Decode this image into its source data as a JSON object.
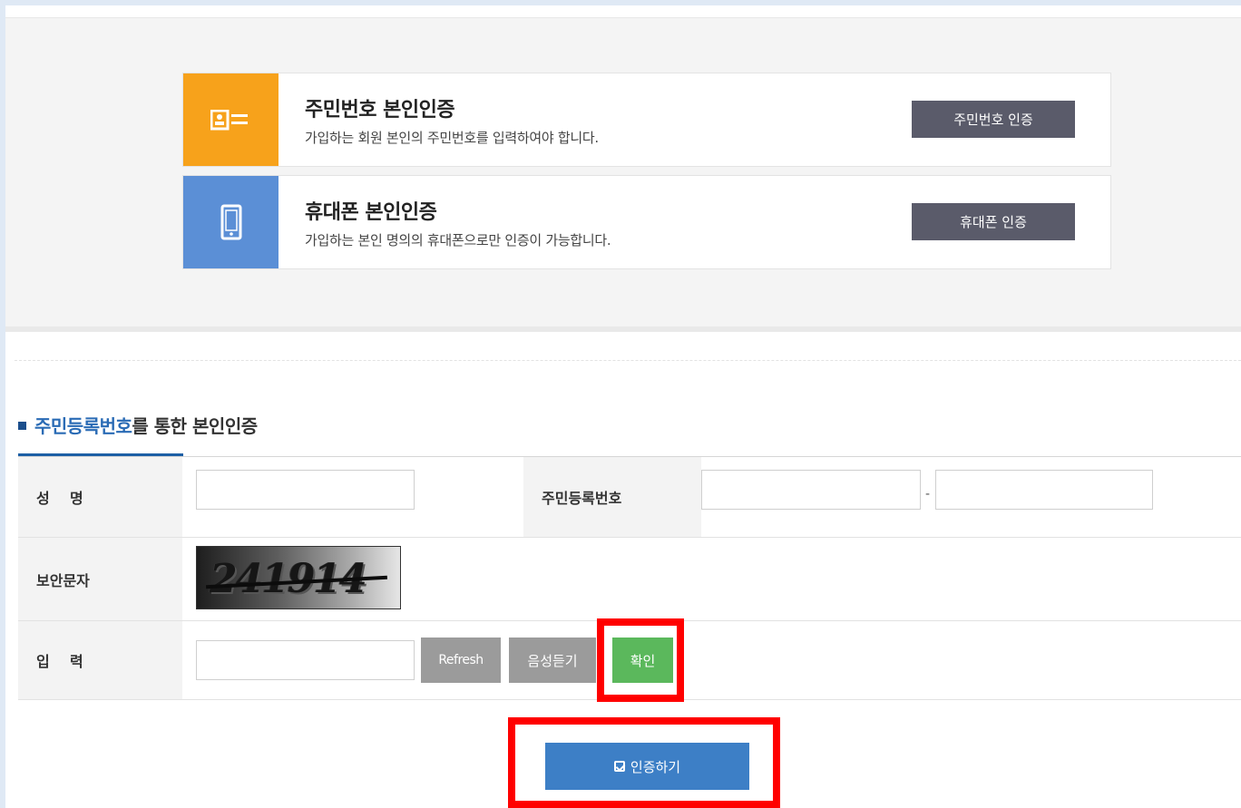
{
  "auth_methods": [
    {
      "title": "주민번호 본인인증",
      "description": "가입하는 회원 본인의 주민번호를 입력하여야 합니다.",
      "button_label": "주민번호 인증",
      "icon": "id-card-icon",
      "color": "#f7a21b"
    },
    {
      "title": "휴대폰 본인인증",
      "description": "가입하는 본인 명의의 휴대폰으로만 인증이 가능합니다.",
      "button_label": "휴대폰 인증",
      "icon": "mobile-phone-icon",
      "color": "#5b8fd6"
    }
  ],
  "section": {
    "title_highlight": "주민등록번호",
    "title_rest": "를 통한 본인인증"
  },
  "form": {
    "name_label": "성    명",
    "name_value": "",
    "rrn_label": "주민등록번호",
    "rrn_first_value": "",
    "rrn_separator": "-",
    "rrn_second_value": "",
    "captcha_label": "보안문자",
    "captcha_text": "241914",
    "input_label": "입    력",
    "input_value": "",
    "refresh_label": "Refresh",
    "audio_label": "음성듣기",
    "confirm_label": "확인"
  },
  "submit": {
    "label": "인증하기",
    "icon": "check-square-icon"
  },
  "colors": {
    "accent": "#3d7fc6",
    "highlight": "#ff0000",
    "confirm": "#5bb85c"
  }
}
